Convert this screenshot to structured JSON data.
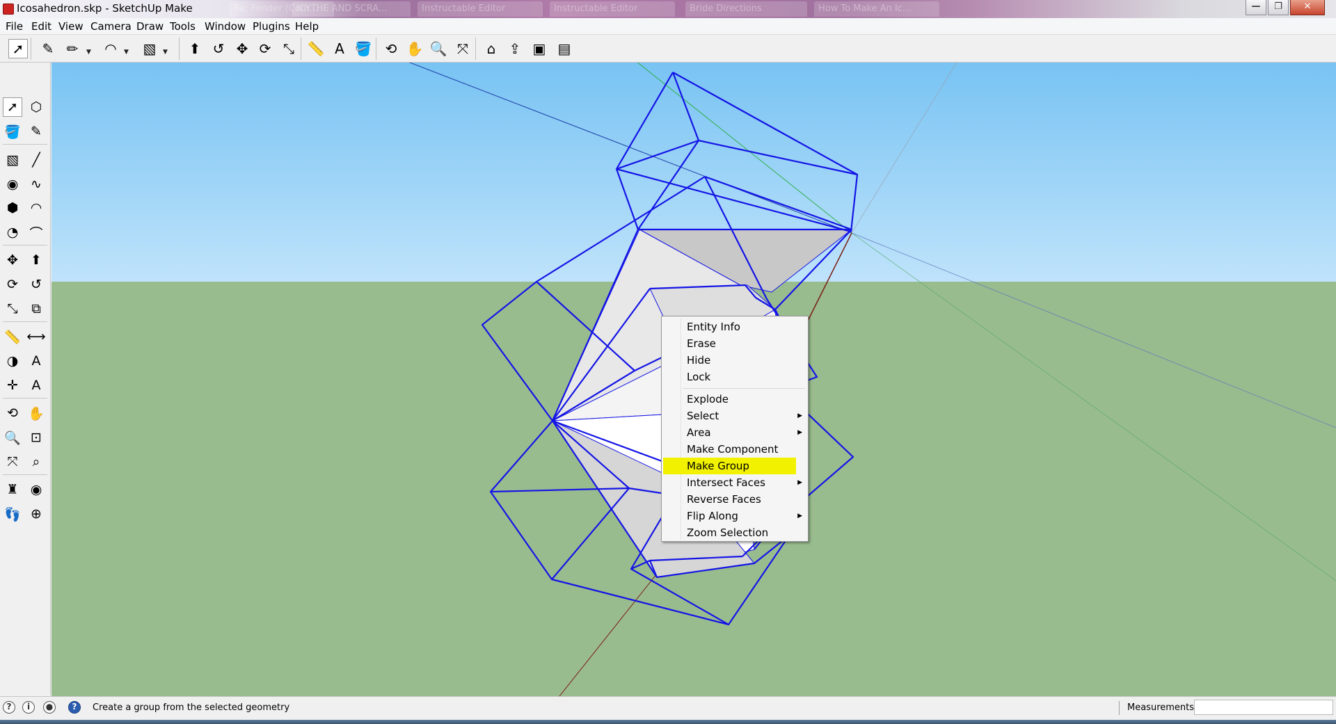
{
  "window": {
    "title": "Icosahedron.skp - SketchUp Make",
    "background_tabs": [
      "Re: Fender (Com...",
      "ICYTHE AND SCRA...",
      "Instructable Editor",
      "Instructable Editor",
      "Bride Directions",
      "How To Make An Ic..."
    ],
    "controls": {
      "minimize": "—",
      "maximize": "❐",
      "close": "✕"
    }
  },
  "menubar": {
    "items": [
      "File",
      "Edit",
      "View",
      "Camera",
      "Draw",
      "Tools",
      "Window",
      "Plugins",
      "Help"
    ]
  },
  "toolbar": {
    "tools": [
      {
        "icon": "select-arrow-icon",
        "glyph": "➚"
      },
      {
        "icon": "eraser-icon",
        "glyph": "✎"
      },
      {
        "icon": "pencil-icon",
        "glyph": "✏"
      },
      {
        "icon": "arc-icon",
        "glyph": "◠"
      },
      {
        "icon": "rectangle-icon",
        "glyph": "▧"
      },
      {
        "icon": "push-pull-icon",
        "glyph": "⬆"
      },
      {
        "icon": "follow-me-icon",
        "glyph": "↺"
      },
      {
        "icon": "move-icon",
        "glyph": "✥"
      },
      {
        "icon": "rotate-icon",
        "glyph": "⟳"
      },
      {
        "icon": "scale-icon",
        "glyph": "⤡"
      },
      {
        "icon": "tape-measure-icon",
        "glyph": "📏"
      },
      {
        "icon": "text-icon",
        "glyph": "A"
      },
      {
        "icon": "paint-bucket-icon",
        "glyph": "🪣"
      },
      {
        "icon": "orbit-icon",
        "glyph": "⟲"
      },
      {
        "icon": "pan-icon",
        "glyph": "✋"
      },
      {
        "icon": "zoom-icon",
        "glyph": "🔍"
      },
      {
        "icon": "zoom-extents-icon",
        "glyph": "⤧"
      },
      {
        "icon": "get-models-icon",
        "glyph": "⌂"
      },
      {
        "icon": "share-model-icon",
        "glyph": "⇪"
      },
      {
        "icon": "extension-warehouse-icon",
        "glyph": "▣"
      },
      {
        "icon": "layout-icon",
        "glyph": "▤"
      }
    ]
  },
  "left_toolbar": {
    "tools": [
      {
        "icon": "select-arrow-icon",
        "glyph": "➚"
      },
      {
        "icon": "make-component-icon",
        "glyph": "⬡"
      },
      {
        "icon": "paint-bucket-icon",
        "glyph": "🪣"
      },
      {
        "icon": "eraser-icon",
        "glyph": "✎"
      },
      {
        "icon": "rectangle-icon",
        "glyph": "▧"
      },
      {
        "icon": "line-icon",
        "glyph": "╱"
      },
      {
        "icon": "circle-icon",
        "glyph": "◉"
      },
      {
        "icon": "freehand-icon",
        "glyph": "∿"
      },
      {
        "icon": "polygon-icon",
        "glyph": "⬢"
      },
      {
        "icon": "arc-icon",
        "glyph": "◠"
      },
      {
        "icon": "pie-icon",
        "glyph": "◔"
      },
      {
        "icon": "two-point-arc-icon",
        "glyph": "⌒"
      },
      {
        "icon": "move-icon",
        "glyph": "✥"
      },
      {
        "icon": "push-pull-icon",
        "glyph": "⬆"
      },
      {
        "icon": "rotate-icon",
        "glyph": "⟳"
      },
      {
        "icon": "follow-me-icon",
        "glyph": "↺"
      },
      {
        "icon": "scale-icon",
        "glyph": "⤡"
      },
      {
        "icon": "offset-icon",
        "glyph": "⧉"
      },
      {
        "icon": "tape-measure-icon",
        "glyph": "📏"
      },
      {
        "icon": "dimension-icon",
        "glyph": "⟷"
      },
      {
        "icon": "protractor-icon",
        "glyph": "◑"
      },
      {
        "icon": "text-icon",
        "glyph": "A"
      },
      {
        "icon": "axes-icon",
        "glyph": "✛"
      },
      {
        "icon": "3d-text-icon",
        "glyph": "A"
      },
      {
        "icon": "orbit-icon",
        "glyph": "⟲"
      },
      {
        "icon": "pan-icon",
        "glyph": "✋"
      },
      {
        "icon": "zoom-icon",
        "glyph": "🔍"
      },
      {
        "icon": "zoom-window-icon",
        "glyph": "⊡"
      },
      {
        "icon": "zoom-extents-icon",
        "glyph": "⤧"
      },
      {
        "icon": "previous-view-icon",
        "glyph": "⌕"
      },
      {
        "icon": "position-camera-icon",
        "glyph": "♜"
      },
      {
        "icon": "look-around-icon",
        "glyph": "◉"
      },
      {
        "icon": "walk-icon",
        "glyph": "👣"
      },
      {
        "icon": "section-plane-icon",
        "glyph": "⊕"
      }
    ]
  },
  "colors": {
    "selection_edges": "#1414e6",
    "face_shaded": "#c8c8c8",
    "face_light": "#ececec",
    "sky": "#78c3f3",
    "ground": "#99bc8f",
    "axis_red": "#7a1a10",
    "axis_green": "#2fae4a",
    "axis_blue": "#1c3fa8",
    "menu_highlight": "#f2f200"
  },
  "context_menu": {
    "groups": [
      [
        {
          "label": "Entity Info"
        },
        {
          "label": "Erase"
        },
        {
          "label": "Hide"
        },
        {
          "label": "Lock"
        }
      ],
      [
        {
          "label": "Explode"
        },
        {
          "label": "Select",
          "submenu": true
        },
        {
          "label": "Area",
          "submenu": true
        },
        {
          "label": "Make Component"
        },
        {
          "label": "Make Group",
          "highlighted": true
        },
        {
          "label": "Intersect Faces",
          "submenu": true
        },
        {
          "label": "Reverse Faces"
        },
        {
          "label": "Flip Along",
          "submenu": true
        },
        {
          "label": "Zoom Selection"
        }
      ]
    ]
  },
  "statusbar": {
    "icons": [
      "geolocation-icon",
      "credits-icon",
      "user-icon",
      "help-icon"
    ],
    "message": "Create a group from the selected geometry",
    "measurements_label": "Measurements",
    "measurements_value": ""
  }
}
